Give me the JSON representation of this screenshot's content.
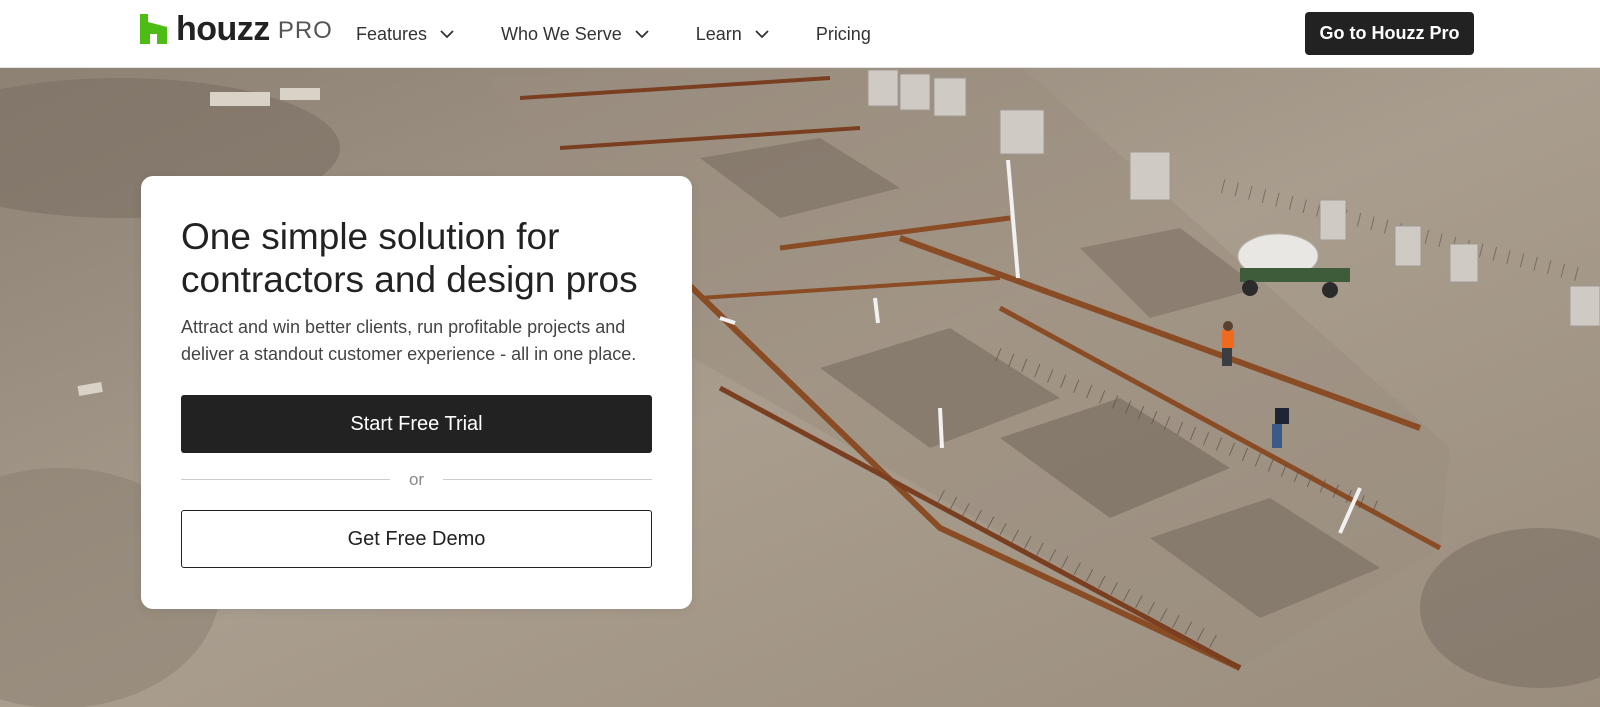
{
  "brand": {
    "wordmark": "houzz",
    "suffix": "PRO",
    "accent_color": "#4DBC15",
    "logo_icon": "houzz-h-icon"
  },
  "nav": {
    "items": [
      {
        "label": "Features",
        "has_dropdown": true
      },
      {
        "label": "Who We Serve",
        "has_dropdown": true
      },
      {
        "label": "Learn",
        "has_dropdown": true
      },
      {
        "label": "Pricing",
        "has_dropdown": false
      }
    ],
    "dropdown_icon": "chevron-down-icon",
    "cta_label": "Go to Houzz Pro"
  },
  "hero": {
    "image_description_icon": "construction-site-photo",
    "card": {
      "title": "One simple solution for contractors and design pros",
      "subtitle": "Attract and win better clients, run profitable projects and deliver a standout customer experience - all in one place.",
      "primary_cta": "Start Free Trial",
      "divider_text": "or",
      "secondary_cta": "Get Free Demo"
    }
  },
  "colors": {
    "button_dark": "#222222",
    "ground": "#A89C8C"
  }
}
